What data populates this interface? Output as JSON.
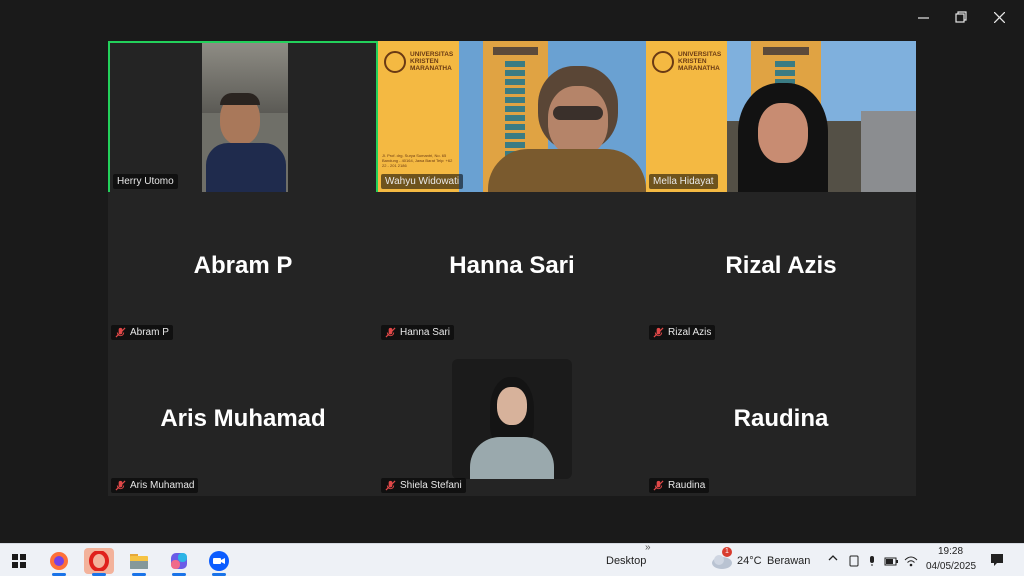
{
  "window": {
    "controls": [
      "minimize",
      "restore",
      "close"
    ]
  },
  "participants": [
    {
      "name": "Herry Utomo",
      "has_video": true,
      "active_speaker": true
    },
    {
      "name": "Wahyu Widowati",
      "has_video": true
    },
    {
      "name": "Mella Hidayat",
      "has_video": true
    },
    {
      "name": "Abram P",
      "big_label": "Abram P",
      "muted": true
    },
    {
      "name": "Hanna Sari",
      "big_label": "Hanna Sari",
      "muted": true
    },
    {
      "name": "Rizal Azis",
      "big_label": "Rizal Azis",
      "muted": true
    },
    {
      "name": "Aris Muhamad",
      "big_label": "Aris Muhamad",
      "muted": true
    },
    {
      "name": "Shiela Stefani",
      "has_photo": true,
      "muted": true
    },
    {
      "name": "Raudina",
      "big_label": "Raudina",
      "muted": true
    }
  ],
  "poster": {
    "line1": "UNIVERSITAS",
    "line2": "KRISTEN",
    "line3": "MARANATHA",
    "address": "Jl. Prof. drg. Surya Sumantri, No. 65 Bandung - 40164, Jawa Barat Telp: +62 22 - 201 2186"
  },
  "taskbar": {
    "icons": [
      "windows-start",
      "firefox",
      "opera",
      "file-explorer",
      "m365",
      "zoom"
    ],
    "desktop_label": "Desktop",
    "chevron": "»",
    "weather": {
      "temp": "24°C",
      "condition": "Berawan",
      "badge": "1"
    },
    "time": "19:28",
    "date": "04/05/2025"
  },
  "colors": {
    "active_border": "#23d05b",
    "tile_bg": "#242424",
    "taskbar_bg": "#eef1f6"
  }
}
